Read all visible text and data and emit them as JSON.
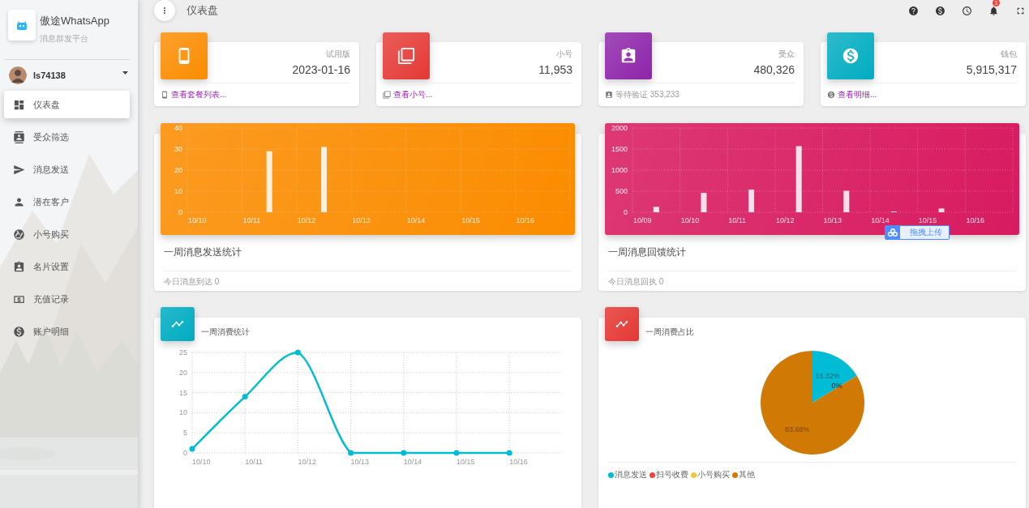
{
  "sidebar": {
    "brand": {
      "title": "傲途WhatsApp",
      "subtitle": "消息群发平台"
    },
    "user": {
      "name": "ls74138"
    },
    "items": [
      {
        "label": "仪表盘",
        "selected": true
      },
      {
        "label": "受众筛选",
        "selected": false
      },
      {
        "label": "消息发送",
        "selected": false
      },
      {
        "label": "潜在客户",
        "selected": false
      },
      {
        "label": "小号购买",
        "selected": false
      },
      {
        "label": "名片设置",
        "selected": false
      },
      {
        "label": "充值记录",
        "selected": false
      },
      {
        "label": "账户明细",
        "selected": false
      }
    ]
  },
  "topbar": {
    "title": "仪表盘",
    "notification_count": "3"
  },
  "stat_cards": [
    {
      "label": "试用版",
      "value": "2023-01-16",
      "footer": "查看套餐列表...",
      "kind": "link",
      "color": "#fb8c00"
    },
    {
      "label": "小号",
      "value": "11,953",
      "footer": "查看小号...",
      "kind": "link",
      "color": "#e53935"
    },
    {
      "label": "受众",
      "value": "480,326",
      "footer": "等待验证 353,233",
      "kind": "text",
      "color": "#8e24aa"
    },
    {
      "label": "钱包",
      "value": "5,915,317",
      "footer": "查看明细...",
      "kind": "link",
      "color": "#00acc1"
    }
  ],
  "chart_cards": [
    {
      "title": "一周消息发送统计",
      "footer": "今日消息到达 0",
      "color": "#fb8c00",
      "chart_data": {
        "type": "bar",
        "categories": [
          "10/10",
          "10/11",
          "10/12",
          "10/13",
          "10/14",
          "10/15",
          "10/16"
        ],
        "values": [
          0,
          29,
          31,
          0,
          0,
          0,
          0
        ],
        "grid": true,
        "ylim": [
          0,
          40
        ],
        "yticks": [
          0,
          10,
          20,
          30,
          40
        ]
      }
    },
    {
      "title": "一周消息回馈统计",
      "footer": "今日消息回执 0",
      "color": "#d81b60",
      "chart_data": {
        "type": "bar",
        "categories": [
          "10/09",
          "10/10",
          "10/11",
          "10/12",
          "10/13",
          "10/14",
          "10/15",
          "10/16"
        ],
        "values": [
          130,
          460,
          540,
          1570,
          510,
          20,
          90,
          0
        ],
        "grid": true,
        "ylim": [
          0,
          2000
        ],
        "yticks": [
          0,
          500,
          1000,
          1500,
          2000
        ]
      }
    }
  ],
  "upload_widget": {
    "label": "拖拽上传"
  },
  "line_card": {
    "title": "一周消费统计",
    "color": "#00acc1",
    "chart_data": {
      "type": "line",
      "categories": [
        "10/10",
        "10/11",
        "10/12",
        "10/13",
        "10/14",
        "10/15",
        "10/16"
      ],
      "series": [
        {
          "color": "#00bcd4",
          "marker": true,
          "values": [
            1,
            14,
            25,
            0,
            0,
            0,
            0
          ]
        }
      ],
      "grid": true,
      "ylim": [
        0,
        25
      ],
      "yticks": [
        0,
        5,
        10,
        15,
        20,
        25
      ]
    }
  },
  "pie_card": {
    "title": "一周消费占比",
    "color": "#e53935",
    "chart_data": {
      "type": "pie",
      "categories": [
        "消息发送",
        "扫号收费",
        "小号购买",
        "其他"
      ],
      "values": [
        16.32,
        0,
        0,
        83.68
      ],
      "colors": [
        "#00bcd4",
        "#f44336",
        "#f4c63d",
        "#d17905"
      ],
      "value_labels": [
        "16.32%",
        "0%",
        null,
        "83.68%"
      ]
    }
  }
}
